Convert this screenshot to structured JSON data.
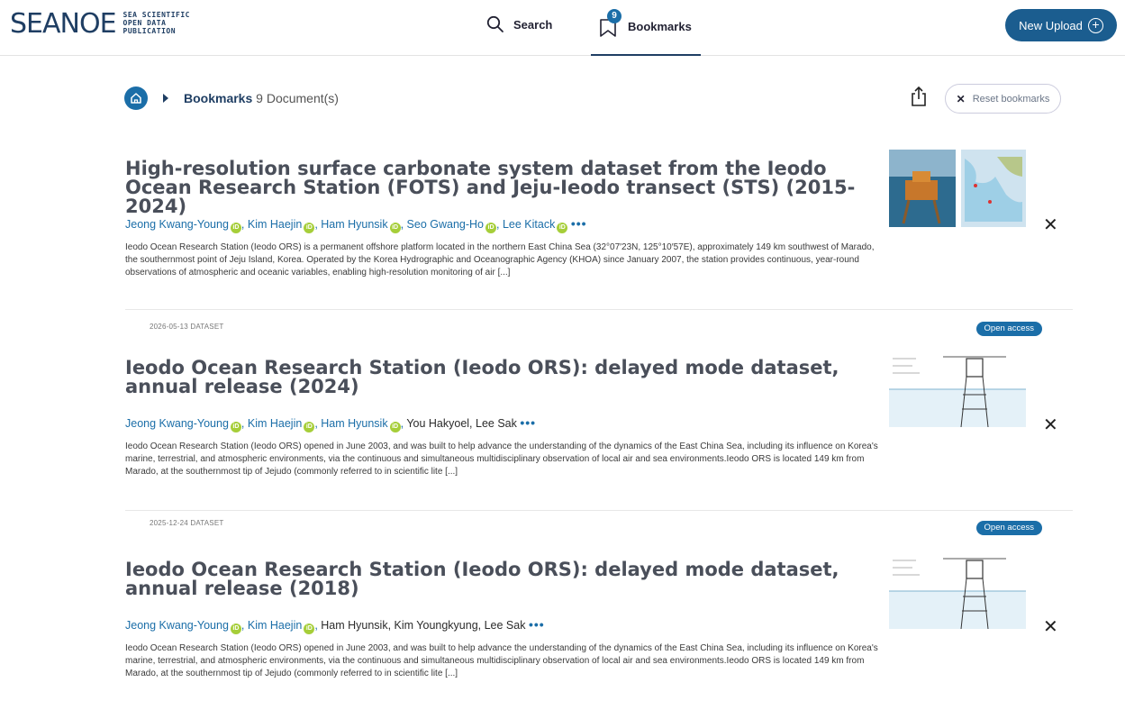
{
  "header": {
    "logo_word": "SEANOE",
    "logo_lines": [
      "SEA SCIENTIFIC",
      "OPEN DATA",
      "PUBLICATION"
    ],
    "search_label": "Search",
    "bookmarks_label": "Bookmarks",
    "bookmarks_count": "9",
    "upload_label": "New Upload",
    "upload_icon": "plus-circle-icon"
  },
  "breadcrumb": {
    "section": "Bookmarks",
    "count_text": "9 Document(s)",
    "reset_label": "Reset bookmarks"
  },
  "records": [
    {
      "title": "High-resolution surface carbonate system dataset from the Ieodo Ocean Research Station (FOTS) and Jeju-Ieodo transect (STS) (2015-2024)",
      "authors_orcid": [
        "Jeong Kwang-Young",
        "Kim Haejin",
        "Ham Hyunsik",
        "Seo Gwang-Ho",
        "Lee Kitack"
      ],
      "authors_plain": "",
      "more": "•••",
      "abstract": "Ieodo Ocean Research Station (Ieodo ORS) is a permanent offshore platform located in the northern East China Sea (32°07′23N, 125°10′57E), approximately 149 km southwest of Marado, the southernmost point of Jeju Island, Korea. Operated by the Korea Hydrographic and Oceanographic Agency (KHOA) since January 2007, the station provides continuous, year-round observations of atmospheric and oceanic variables, enabling high-resolution monitoring of air [...]",
      "meta": "2026-05-13 DATASET",
      "access": "Open access",
      "close": "✕"
    },
    {
      "title": "Ieodo Ocean Research Station (Ieodo ORS): delayed mode dataset, annual release (2024)",
      "authors_orcid": [
        "Jeong Kwang-Young",
        "Kim Haejin",
        "Ham Hyunsik"
      ],
      "authors_plain": "You Hakyoel, Lee Sak",
      "more": "•••",
      "abstract": "Ieodo Ocean Research Station (Ieodo ORS) opened in June 2003, and was built to help advance the understanding of the dynamics of the East China Sea, including its influence on Korea's marine, terrestrial, and atmospheric environments, via the continuous and simultaneous multidisciplinary observation of local air and sea environments.Ieodo ORS is located 149 km from Marado, at the southernmost tip of Jejudo (commonly referred to in scientific lite [...]",
      "meta": "2025-12-24 DATASET",
      "access": "Open access",
      "close": "✕"
    },
    {
      "title": "Ieodo Ocean Research Station (Ieodo ORS): delayed mode dataset, annual release (2018)",
      "authors_orcid": [
        "Jeong Kwang-Young",
        "Kim Haejin"
      ],
      "authors_plain": "Ham Hyunsik, Kim Youngkyung, Lee Sak",
      "more": "•••",
      "abstract": "Ieodo Ocean Research Station (Ieodo ORS) opened in June 2003, and was built to help advance the understanding of the dynamics of the East China Sea, including its influence on Korea's marine, terrestrial, and atmospheric environments, via the continuous and simultaneous multidisciplinary observation of local air and sea environments.Ieodo ORS is located 149 km from Marado, at the southernmost tip of Jejudo (commonly referred to in scientific lite [...]",
      "close": "✕"
    }
  ],
  "colors": {
    "brand": "#1f3e63",
    "accent": "#1b6ea8",
    "button": "#1b5d8f",
    "orcid": "#a6ce39"
  }
}
